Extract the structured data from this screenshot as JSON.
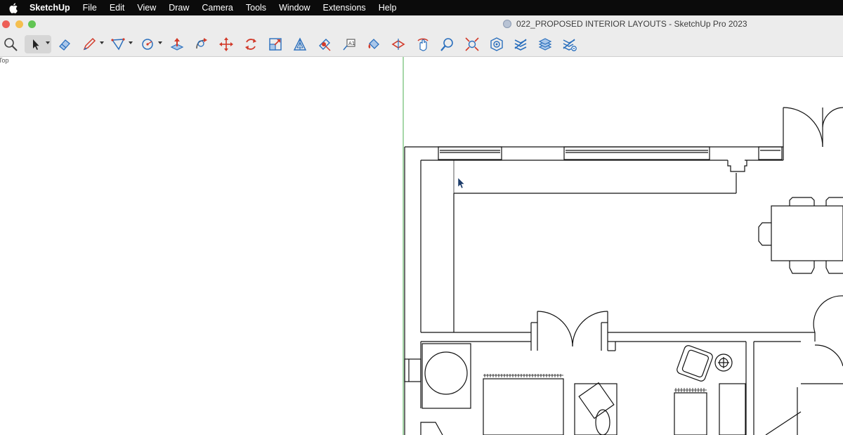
{
  "menubar": {
    "apple_icon": "apple-icon",
    "items": [
      {
        "name": "menu-sketchup",
        "label": "SketchUp"
      },
      {
        "name": "menu-file",
        "label": "File"
      },
      {
        "name": "menu-edit",
        "label": "Edit"
      },
      {
        "name": "menu-view",
        "label": "View"
      },
      {
        "name": "menu-draw",
        "label": "Draw"
      },
      {
        "name": "menu-camera",
        "label": "Camera"
      },
      {
        "name": "menu-tools",
        "label": "Tools"
      },
      {
        "name": "menu-window",
        "label": "Window"
      },
      {
        "name": "menu-extensions",
        "label": "Extensions"
      },
      {
        "name": "menu-help",
        "label": "Help"
      }
    ]
  },
  "window": {
    "title": "022_PROPOSED INTERIOR LAYOUTS - SketchUp Pro 2023"
  },
  "toolbar": {
    "tools": [
      "search-icon",
      "select-icon",
      "eraser-icon",
      "pencil-icon",
      "shapes-icon",
      "arc-icon",
      "push-pull-icon",
      "follow-me-icon",
      "move-icon",
      "rotate-icon",
      "scale-icon",
      "offset-icon",
      "tape-measure-icon",
      "text-icon",
      "paint-bucket-icon",
      "section-plane-icon",
      "orbit-icon",
      "zoom-icon",
      "zoom-extents-icon",
      "warehouse-icon",
      "extension-warehouse-icon",
      "layout-icon",
      "extension-manager-icon"
    ]
  },
  "viewport": {
    "view_label": "Top"
  },
  "colors": {
    "menubar_bg": "#0b0b0b",
    "toolbar_bg": "#ececec",
    "icon_blue": "#2a6fbd",
    "icon_red": "#d23a2a",
    "axis_green": "#4caf50"
  }
}
